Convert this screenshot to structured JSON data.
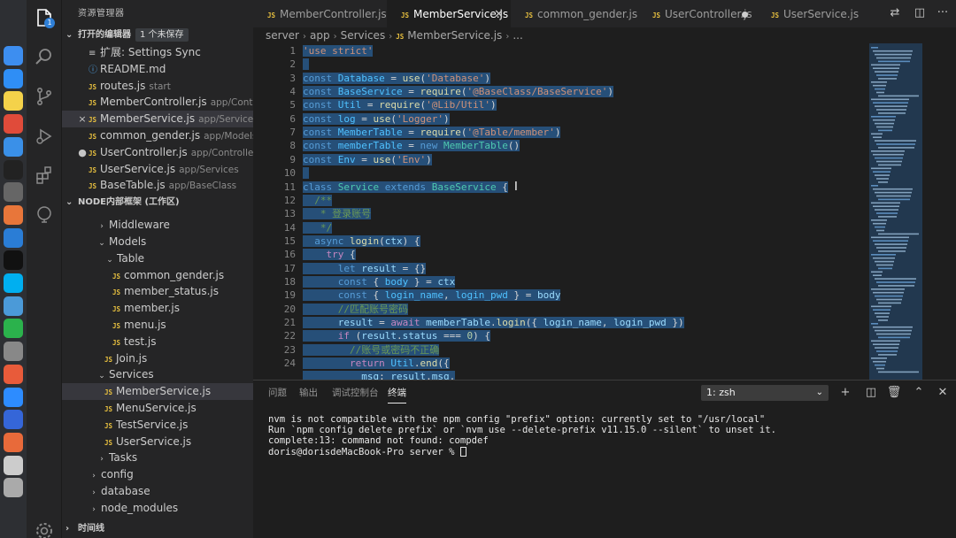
{
  "colors": {
    "selection": "#264f78",
    "editor_bg": "#1e1e1e",
    "sidebar_bg": "#252526",
    "js_icon": "#e8c03f",
    "keyword": "#569cd6",
    "string": "#ce9178",
    "comment": "#6a9955"
  },
  "dock": {
    "icons": [
      "finder-icon",
      "app-store-icon",
      "notes-icon",
      "chrome-icon",
      "safari-icon",
      "terminal-icon",
      "bug-icon",
      "firefox-icon",
      "vscode-icon",
      "qq-icon",
      "skype-icon",
      "browser-icon",
      "wechat-icon",
      "calculator-icon",
      "alarm-icon",
      "zoom-icon",
      "wps-icon",
      "safari-icon",
      "screen-icon",
      "trash-icon"
    ]
  },
  "activity_bar": {
    "explorer_badge": "1",
    "icons": [
      "files-icon",
      "search-icon",
      "source-control-icon",
      "run-debug-icon",
      "extensions-icon",
      "remote-icon",
      "gear-icon"
    ]
  },
  "sidebar": {
    "title": "资源管理器",
    "open_editors": {
      "label": "打开的编辑器",
      "unsaved": "1 个未保存",
      "items": [
        {
          "icon": "gear",
          "name": "扩展: Settings Sync",
          "path": "",
          "lead": ""
        },
        {
          "icon": "info",
          "name": "README.md",
          "path": "",
          "lead": ""
        },
        {
          "icon": "js",
          "name": "routes.js",
          "path": "start",
          "lead": ""
        },
        {
          "icon": "js",
          "name": "MemberController.js",
          "path": "app/Controll...",
          "lead": ""
        },
        {
          "icon": "js",
          "name": "MemberService.js",
          "path": "app/Services",
          "lead": "×"
        },
        {
          "icon": "js",
          "name": "common_gender.js",
          "path": "app/Models/T...",
          "lead": ""
        },
        {
          "icon": "js",
          "name": "UserController.js",
          "path": "app/Controllers/...",
          "lead": "●"
        },
        {
          "icon": "js",
          "name": "UserService.js",
          "path": "app/Services",
          "lead": ""
        },
        {
          "icon": "js",
          "name": "BaseTable.js",
          "path": "app/BaseClass",
          "lead": ""
        }
      ]
    },
    "workspace": {
      "label": "NODE内部框架 (工作区)",
      "tree": [
        {
          "type": "folder",
          "name": "Middleware",
          "indent": 1,
          "open": false
        },
        {
          "type": "folder",
          "name": "Models",
          "indent": 1,
          "open": true
        },
        {
          "type": "folder",
          "name": "Table",
          "indent": 2,
          "open": true
        },
        {
          "type": "file",
          "name": "common_gender.js",
          "indent": 3
        },
        {
          "type": "file",
          "name": "member_status.js",
          "indent": 3
        },
        {
          "type": "file",
          "name": "member.js",
          "indent": 3
        },
        {
          "type": "file",
          "name": "menu.js",
          "indent": 3
        },
        {
          "type": "file",
          "name": "test.js",
          "indent": 3
        },
        {
          "type": "file",
          "name": "Join.js",
          "indent": 2
        },
        {
          "type": "folder",
          "name": "Services",
          "indent": 1,
          "open": true
        },
        {
          "type": "file",
          "name": "MemberService.js",
          "indent": 2,
          "selected": true
        },
        {
          "type": "file",
          "name": "MenuService.js",
          "indent": 2
        },
        {
          "type": "file",
          "name": "TestService.js",
          "indent": 2
        },
        {
          "type": "file",
          "name": "UserService.js",
          "indent": 2
        },
        {
          "type": "folder",
          "name": "Tasks",
          "indent": 1,
          "open": false
        },
        {
          "type": "folder",
          "name": "config",
          "indent": 0,
          "open": false
        },
        {
          "type": "folder",
          "name": "database",
          "indent": 0,
          "open": false
        },
        {
          "type": "folder",
          "name": "node_modules",
          "indent": 0,
          "open": false
        }
      ]
    },
    "timeline": {
      "label": "时间线"
    }
  },
  "tabs": [
    {
      "name": "MemberController.js",
      "active": false,
      "state": ""
    },
    {
      "name": "MemberService.js",
      "active": true,
      "state": "close"
    },
    {
      "name": "common_gender.js",
      "active": false,
      "state": ""
    },
    {
      "name": "UserController.js",
      "active": false,
      "state": "dirty"
    },
    {
      "name": "UserService.js",
      "active": false,
      "state": ""
    }
  ],
  "breadcrumb": [
    "server",
    "app",
    "Services",
    "MemberService.js",
    "..."
  ],
  "editor": {
    "lines": [
      {
        "n": "1",
        "tokens": [
          [
            "st",
            "'use strict'"
          ]
        ]
      },
      {
        "n": "2",
        "tokens": []
      },
      {
        "n": "3",
        "tokens": [
          [
            "kw",
            "const"
          ],
          [
            "",
            " "
          ],
          [
            "cn",
            "Database"
          ],
          [
            "",
            " = "
          ],
          [
            "fn",
            "use"
          ],
          [
            "",
            "("
          ],
          [
            "st",
            "'Database'"
          ],
          [
            "",
            ")"
          ]
        ]
      },
      {
        "n": "4",
        "tokens": [
          [
            "kw",
            "const"
          ],
          [
            "",
            " "
          ],
          [
            "cn",
            "BaseService"
          ],
          [
            "",
            " = "
          ],
          [
            "fn",
            "require"
          ],
          [
            "",
            "("
          ],
          [
            "st",
            "'@BaseClass/BaseService'"
          ],
          [
            "",
            ")"
          ]
        ]
      },
      {
        "n": "5",
        "tokens": [
          [
            "kw",
            "const"
          ],
          [
            "",
            " "
          ],
          [
            "cn",
            "Util"
          ],
          [
            "",
            " = "
          ],
          [
            "fn",
            "require"
          ],
          [
            "",
            "("
          ],
          [
            "st",
            "'@Lib/Util'"
          ],
          [
            "",
            ")"
          ]
        ]
      },
      {
        "n": "6",
        "tokens": [
          [
            "kw",
            "const"
          ],
          [
            "",
            " "
          ],
          [
            "cn",
            "log"
          ],
          [
            "",
            " = "
          ],
          [
            "fn",
            "use"
          ],
          [
            "",
            "("
          ],
          [
            "st",
            "'Logger'"
          ],
          [
            "",
            ")"
          ]
        ]
      },
      {
        "n": "7",
        "tokens": [
          [
            "kw",
            "const"
          ],
          [
            "",
            " "
          ],
          [
            "cn",
            "MemberTable"
          ],
          [
            "",
            " = "
          ],
          [
            "fn",
            "require"
          ],
          [
            "",
            "("
          ],
          [
            "st",
            "'@Table/member'"
          ],
          [
            "",
            ")"
          ]
        ]
      },
      {
        "n": "8",
        "tokens": [
          [
            "kw",
            "const"
          ],
          [
            "",
            " "
          ],
          [
            "cn",
            "memberTable"
          ],
          [
            "",
            " = "
          ],
          [
            "kw",
            "new"
          ],
          [
            "",
            " "
          ],
          [
            "cls",
            "MemberTable"
          ],
          [
            "",
            "()"
          ]
        ]
      },
      {
        "n": "9",
        "tokens": [
          [
            "kw",
            "const"
          ],
          [
            "",
            " "
          ],
          [
            "cn",
            "Env"
          ],
          [
            "",
            " = "
          ],
          [
            "fn",
            "use"
          ],
          [
            "",
            "("
          ],
          [
            "st",
            "'Env'"
          ],
          [
            "",
            ")"
          ]
        ]
      },
      {
        "n": "10",
        "tokens": []
      },
      {
        "n": "11",
        "tokens": [
          [
            "kw",
            "class"
          ],
          [
            "",
            " "
          ],
          [
            "cls",
            "Service"
          ],
          [
            "",
            " "
          ],
          [
            "kw",
            "extends"
          ],
          [
            "",
            " "
          ],
          [
            "cls",
            "BaseService"
          ],
          [
            "",
            " {"
          ]
        ]
      },
      {
        "n": "12",
        "tokens": [
          [
            "",
            "  "
          ],
          [
            "cm",
            "/**"
          ]
        ]
      },
      {
        "n": "13",
        "tokens": [
          [
            "",
            "   "
          ],
          [
            "cm",
            "* 登录账号"
          ]
        ]
      },
      {
        "n": "14",
        "tokens": [
          [
            "",
            "   "
          ],
          [
            "cm",
            "*/"
          ]
        ]
      },
      {
        "n": "15",
        "tokens": [
          [
            "",
            "  "
          ],
          [
            "kw",
            "async"
          ],
          [
            "",
            " "
          ],
          [
            "fn",
            "login"
          ],
          [
            "",
            "("
          ],
          [
            "vr",
            "ctx"
          ],
          [
            "",
            ") {"
          ]
        ]
      },
      {
        "n": "16",
        "tokens": [
          [
            "",
            "    "
          ],
          [
            "ctl",
            "try"
          ],
          [
            "",
            " {"
          ]
        ]
      },
      {
        "n": "17",
        "tokens": [
          [
            "",
            "      "
          ],
          [
            "kw",
            "let"
          ],
          [
            "",
            " "
          ],
          [
            "vr",
            "result"
          ],
          [
            "",
            " = {}"
          ]
        ]
      },
      {
        "n": "18",
        "tokens": [
          [
            "",
            "      "
          ],
          [
            "kw",
            "const"
          ],
          [
            "",
            " { "
          ],
          [
            "cn",
            "body"
          ],
          [
            "",
            " } = "
          ],
          [
            "vr",
            "ctx"
          ]
        ]
      },
      {
        "n": "19",
        "tokens": [
          [
            "",
            "      "
          ],
          [
            "kw",
            "const"
          ],
          [
            "",
            " { "
          ],
          [
            "cn",
            "login_name"
          ],
          [
            "",
            ", "
          ],
          [
            "cn",
            "login_pwd"
          ],
          [
            "",
            " } = "
          ],
          [
            "vr",
            "body"
          ]
        ]
      },
      {
        "n": "20",
        "tokens": [
          [
            "",
            "      "
          ],
          [
            "cm",
            "//匹配账号密码"
          ]
        ]
      },
      {
        "n": "21",
        "tokens": [
          [
            "",
            "      "
          ],
          [
            "vr",
            "result"
          ],
          [
            "",
            " = "
          ],
          [
            "ctl",
            "await"
          ],
          [
            "",
            " "
          ],
          [
            "vr",
            "memberTable"
          ],
          [
            "",
            "."
          ],
          [
            "fn",
            "login"
          ],
          [
            "",
            "({ "
          ],
          [
            "vr",
            "login_name"
          ],
          [
            "",
            ", "
          ],
          [
            "vr",
            "login_pwd"
          ],
          [
            "",
            " })"
          ]
        ]
      },
      {
        "n": "22",
        "tokens": [
          [
            "",
            "      "
          ],
          [
            "ctl",
            "if"
          ],
          [
            "",
            " ("
          ],
          [
            "vr",
            "result"
          ],
          [
            "",
            "."
          ],
          [
            "vr",
            "status"
          ],
          [
            "",
            " === "
          ],
          [
            "nm",
            "0"
          ],
          [
            "",
            ") {"
          ]
        ]
      },
      {
        "n": "23",
        "tokens": [
          [
            "",
            "        "
          ],
          [
            "cm",
            "//账号或密码不正确"
          ]
        ]
      },
      {
        "n": "24",
        "tokens": [
          [
            "",
            "        "
          ],
          [
            "ctl",
            "return"
          ],
          [
            "",
            " "
          ],
          [
            "cn",
            "Util"
          ],
          [
            "",
            "."
          ],
          [
            "fn",
            "end"
          ],
          [
            "",
            "({"
          ]
        ]
      },
      {
        "n": "",
        "tokens": [
          [
            "",
            "          "
          ],
          [
            "vr",
            "msg"
          ],
          [
            "",
            ": "
          ],
          [
            "vr",
            "result"
          ],
          [
            "",
            "."
          ],
          [
            "vr",
            "msg"
          ],
          [
            "",
            ","
          ]
        ]
      }
    ]
  },
  "panel": {
    "tabs": [
      "问题",
      "输出",
      "调试控制台",
      "终端"
    ],
    "active_tab": "终端",
    "terminal_select": "1: zsh",
    "terminal_lines": [
      "nvm is not compatible with the npm config \"prefix\" option: currently set to \"/usr/local\"",
      "Run `npm config delete prefix` or `nvm use --delete-prefix v11.15.0 --silent` to unset it.",
      "complete:13: command not found: compdef",
      "doris@dorisdeMacBook-Pro server % "
    ]
  }
}
